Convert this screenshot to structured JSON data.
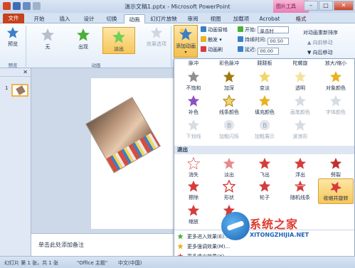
{
  "window": {
    "title": "演示文稿1.pptx - Microsoft PowerPoint",
    "context_tab_group": "图片工具"
  },
  "tabs": [
    {
      "label": "文件"
    },
    {
      "label": "开始"
    },
    {
      "label": "插入"
    },
    {
      "label": "设计"
    },
    {
      "label": "切换"
    },
    {
      "label": "动画"
    },
    {
      "label": "幻灯片放映"
    },
    {
      "label": "审阅"
    },
    {
      "label": "视图"
    },
    {
      "label": "加载项"
    },
    {
      "label": "Acrobat"
    },
    {
      "label": "格式"
    }
  ],
  "ribbon": {
    "preview_label": "预览",
    "preview_group": "预览",
    "gallery": [
      "无",
      "出现",
      "淡出"
    ],
    "effect_options": "效果选项",
    "animation_group": "动画",
    "add_animation": "添加动画",
    "animation_pane": "动画窗格",
    "trigger": "触发",
    "animation_painter": "动画刷",
    "start_label": "开始:",
    "start_value": "单击时",
    "duration_label": "持续时间:",
    "duration_value": "00.50",
    "delay_label": "延迟:",
    "delay_value": "00.00",
    "reorder_title": "对动画重新排序",
    "move_earlier": "向前移动",
    "move_later": "向后移动"
  },
  "slide_panel": {
    "slide_number": "1"
  },
  "notes_placeholder": "单击此处添加备注",
  "status": {
    "slide": "幻灯片 第 1 张，共 1 张",
    "theme": "\"Office 主题\"",
    "lang": "中文(中国)"
  },
  "dropdown": {
    "top_row_partial": [
      "脉冲",
      "彩色脉冲",
      "跷跷板",
      "陀螺旋",
      "放大/缩小"
    ],
    "emphasis_rows": [
      [
        "不饱和",
        "加深",
        "变淡",
        "透明",
        "对象颜色"
      ],
      [
        "补色",
        "线条颜色",
        "填充颜色",
        "画笔颜色",
        "字体颜色"
      ],
      [
        "下划线",
        "加粗闪烁",
        "加粗展示",
        "波浪形"
      ]
    ],
    "exit_section": "退出",
    "exit_rows": [
      [
        "消失",
        "淡出",
        "飞出",
        "浮出",
        "劈裂"
      ],
      [
        "擦除",
        "形状",
        "轮子",
        "随机线条",
        "收缩并旋转"
      ],
      [
        "缩放",
        "旋转"
      ]
    ],
    "links": [
      "更多进入效果(E)...",
      "更多强调效果(M)...",
      "更多退出效果(X)..."
    ]
  },
  "watermark": {
    "name": "系统之家",
    "url": "XITONGZHIJIA.NET"
  },
  "colors": {
    "file_tab": "#c6421c",
    "selected": "#f7c75a",
    "star_gold": "#e8b220",
    "star_green": "#4caf3a",
    "star_red": "#d63c3c"
  }
}
